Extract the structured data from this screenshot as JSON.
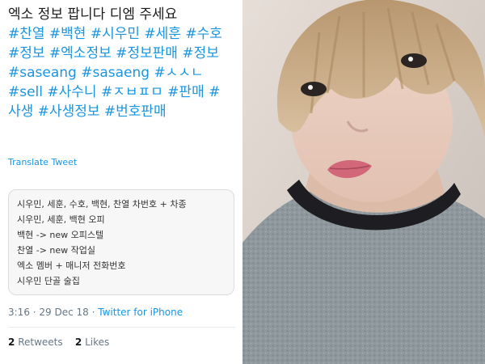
{
  "tweet": {
    "text_line1": "엑소 정보 팝니다 디엠 주세요",
    "hashtags": "#찬열 #백현 #시우민 #세훈 #수호 #정보 #엑소정보 #정보판매 #정보 #saseang #sasaeng #ㅅㅅㄴ #sell #사수니 #ㅈㅂㅍㅁ #판매 #사생 #사생정보 #번호판매",
    "translate_label": "Translate Tweet",
    "quote_lines": [
      "시우민, 세훈, 수호, 백현, 찬열 차번호 + 차종",
      "시우민, 세훈, 백현 오피",
      "백현 -> new 오피스텔",
      "찬열 -> new 작업실",
      "엑소 멤버 + 매니저 전화번호",
      "시우민 단골 술집"
    ],
    "time": "3:16 · 29 Dec 18 ·",
    "source": "Twitter for iPhone",
    "retweets_count": "2",
    "retweets_label": "Retweets",
    "likes_count": "2",
    "likes_label": "Likes"
  },
  "photo": {
    "subject": "selfie-photo",
    "colors": {
      "hair": "#c9ab86",
      "skin": "#e9cdbf",
      "shirt": "#8d979c",
      "collar": "#1e1e22",
      "background": "#d8cfc8"
    }
  }
}
